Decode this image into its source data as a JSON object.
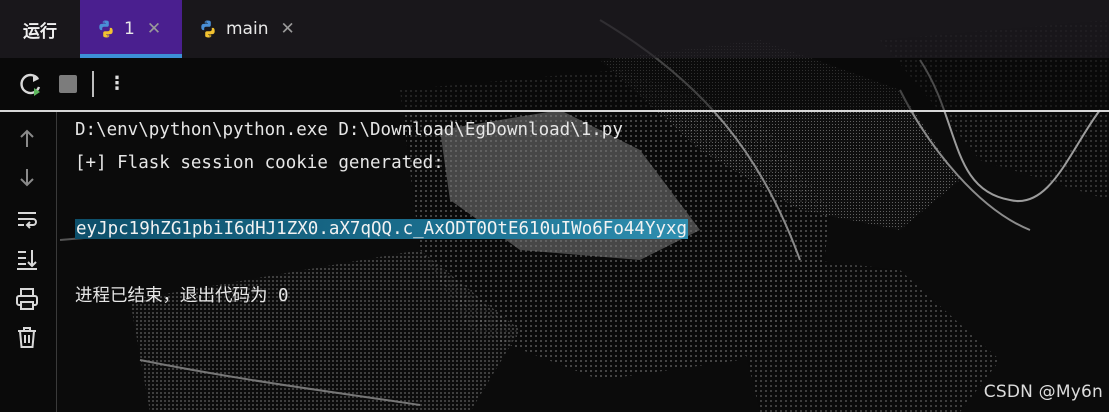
{
  "tabbar": {
    "run_label": "运行",
    "tabs": [
      {
        "label": "1",
        "active": true,
        "icon": "python-icon"
      },
      {
        "label": "main",
        "active": false,
        "icon": "python-icon"
      }
    ],
    "close_glyph": "✕"
  },
  "toolbar": {
    "buttons": [
      "rerun-icon",
      "stop-icon",
      "more-options-icon"
    ]
  },
  "gutter": {
    "icons": [
      "scroll-up-arrow-icon",
      "scroll-down-arrow-icon",
      "soft-wrap-icon",
      "scroll-to-end-icon",
      "print-icon",
      "trash-icon"
    ]
  },
  "console": {
    "lines": [
      "D:\\env\\python\\python.exe D:\\Download\\EgDownload\\1.py",
      "[+] Flask session cookie generated:",
      "",
      "eyJpc19hZG1pbiI6dHJ1ZX0.aX7qQQ.c_AxODT0OtE610uIWo6Fo44Yyxg",
      "",
      "进程已结束，退出代码为 0"
    ],
    "selected_line_index": 3
  },
  "colors": {
    "active_tab_bg": "#4a1f8f",
    "active_tab_underline": "#3d8fd6",
    "selection_bg": "#1b6f8f"
  },
  "watermark": "CSDN @My6n"
}
